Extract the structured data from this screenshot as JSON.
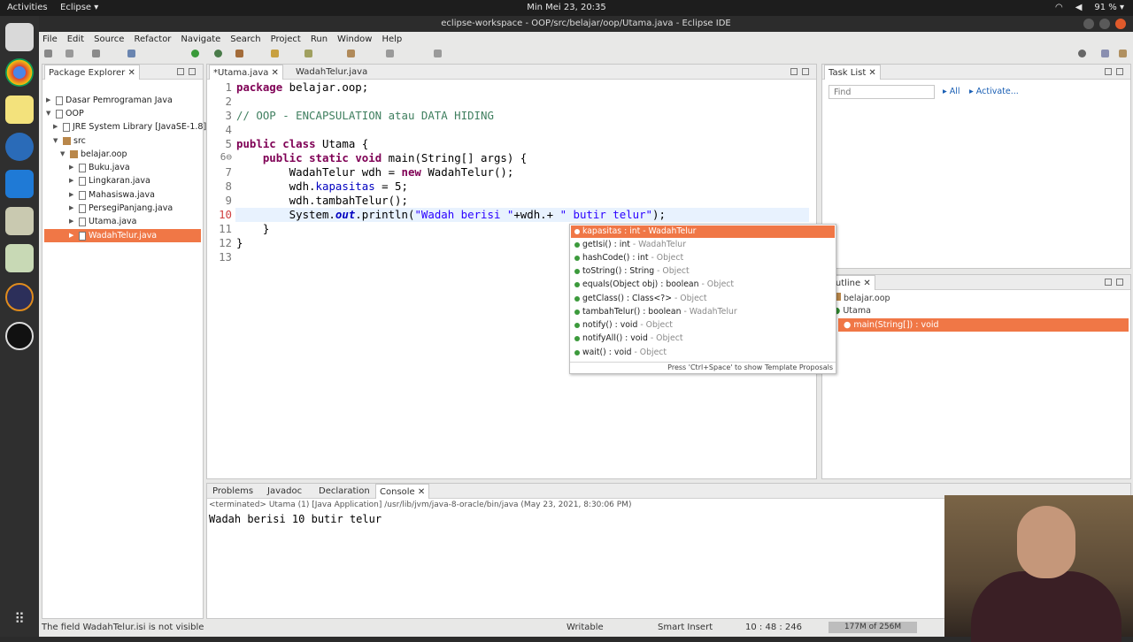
{
  "topbar": {
    "activities": "Activities",
    "app": "Eclipse ▾",
    "clock": "Min Mei 23, 20:35",
    "battery": "91 % ▾"
  },
  "window": {
    "title": "eclipse-workspace - OOP/src/belajar/oop/Utama.java - Eclipse IDE"
  },
  "menu": [
    "File",
    "Edit",
    "Source",
    "Refactor",
    "Navigate",
    "Search",
    "Project",
    "Run",
    "Window",
    "Help"
  ],
  "package_explorer": {
    "title": "Package Explorer ✕",
    "items": [
      "Dasar Pemrograman Java",
      "OOP",
      "JRE System Library [JavaSE-1.8]",
      "src",
      "belajar.oop",
      "Buku.java",
      "Lingkaran.java",
      "Mahasiswa.java",
      "PersegiPanjang.java",
      "Utama.java",
      "WadahTelur.java"
    ]
  },
  "editor": {
    "tabs": [
      "*Utama.java ✕",
      "WadahTelur.java"
    ],
    "line_numbers": [
      "1",
      "2",
      "3",
      "4",
      "5",
      "6⊖",
      "7",
      "8",
      "9",
      "10",
      "11",
      "12",
      "13"
    ],
    "l1a": "package",
    "l1b": " belajar.oop;",
    "l3": "// OOP - ENCAPSULATION atau DATA HIDING",
    "l5a": "public",
    "l5b": " ",
    "l5c": "class",
    "l5d": " Utama {",
    "l6a": "    ",
    "l6b": "public",
    "l6c": " ",
    "l6d": "static",
    "l6e": " ",
    "l6f": "void",
    "l6g": " main(String[] args) {",
    "l7a": "        WadahTelur wdh = ",
    "l7b": "new",
    "l7c": " WadahTelur();",
    "l8a": "        wdh.",
    "l8b": "kapasitas",
    "l8c": " = 5;",
    "l9": "        wdh.tambahTelur();",
    "l10a": "        System.",
    "l10b": "out",
    "l10c": ".println(",
    "l10d": "\"Wadah berisi \"",
    "l10e": "+wdh.+ ",
    "l10f": "\" butir telur\"",
    "l10g": ");",
    "l11": "    }",
    "l12": "}"
  },
  "autocomplete": {
    "items": [
      {
        "sig": "kapasitas : int",
        "src": " - WadahTelur"
      },
      {
        "sig": "getIsi() : int",
        "src": " - WadahTelur"
      },
      {
        "sig": "hashCode() : int",
        "src": " - Object"
      },
      {
        "sig": "toString() : String",
        "src": " - Object"
      },
      {
        "sig": "equals(Object obj) : boolean",
        "src": " - Object"
      },
      {
        "sig": "getClass() : Class<?>",
        "src": " - Object"
      },
      {
        "sig": "tambahTelur() : boolean",
        "src": " - WadahTelur"
      },
      {
        "sig": "notify() : void",
        "src": " - Object"
      },
      {
        "sig": "notifyAll() : void",
        "src": " - Object"
      },
      {
        "sig": "wait() : void",
        "src": " - Object"
      }
    ],
    "footer": "Press 'Ctrl+Space' to show Template Proposals"
  },
  "task_list": {
    "title": "Task List ✕",
    "find_placeholder": "Find",
    "all": "All",
    "activate": "Activate..."
  },
  "outline": {
    "title": "Outline ✕",
    "items": [
      "belajar.oop",
      "Utama",
      "main(String[]) : void"
    ]
  },
  "console": {
    "tabs": [
      "Problems",
      "Javadoc",
      "Declaration",
      "Console ✕"
    ],
    "terminated": "<terminated> Utama (1) [Java Application] /usr/lib/jvm/java-8-oracle/bin/java (May 23, 2021, 8:30:06 PM)",
    "output": "Wadah berisi 10 butir telur"
  },
  "status": {
    "message": "The field WadahTelur.isi is not visible",
    "writable": "Writable",
    "insert": "Smart Insert",
    "position": "10 : 48 : 246",
    "memory": "177M of 256M"
  },
  "colors": {
    "selection": "#f07746",
    "keyword": "#7f0055",
    "comment": "#3f7f5f",
    "string": "#2a00ff"
  }
}
